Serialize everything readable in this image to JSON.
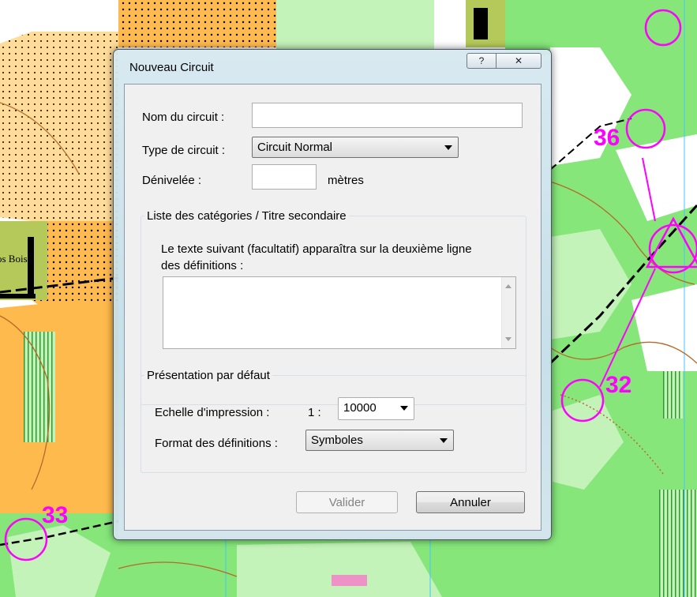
{
  "map": {
    "control_labels": [
      "36",
      "32",
      "33"
    ],
    "place_label": "os Bois",
    "colors": {
      "forest": "#86e67a",
      "light_forest": "#c3f3b8",
      "open": "#ffba4d",
      "rough_open": "#ffdd99",
      "course": "#ff00ff",
      "water_lines": "#42c5ff",
      "path": "#000000"
    }
  },
  "dialog": {
    "title": "Nouveau Circuit",
    "help_glyph": "?",
    "close_glyph": "✕",
    "name_label": "Nom du circuit :",
    "name_value": "",
    "type_label": "Type de circuit :",
    "type_value": "Circuit Normal",
    "climb_label": "Dénivelée :",
    "climb_value": "",
    "climb_unit": "mètres",
    "categories_group": {
      "title": "Liste des catégories / Titre secondaire",
      "description_line1": "Le texte suivant (facultatif) apparaîtra sur la deuxième ligne",
      "description_line2": "des définitions :",
      "text_value": ""
    },
    "presentation_group": {
      "title": "Présentation par défaut",
      "scale_label": "Echelle d'impression :",
      "scale_prefix": "1 :",
      "scale_value": "10000",
      "format_label": "Format des définitions :",
      "format_value": "Symboles"
    },
    "ok_label": "Valider",
    "cancel_label": "Annuler"
  }
}
